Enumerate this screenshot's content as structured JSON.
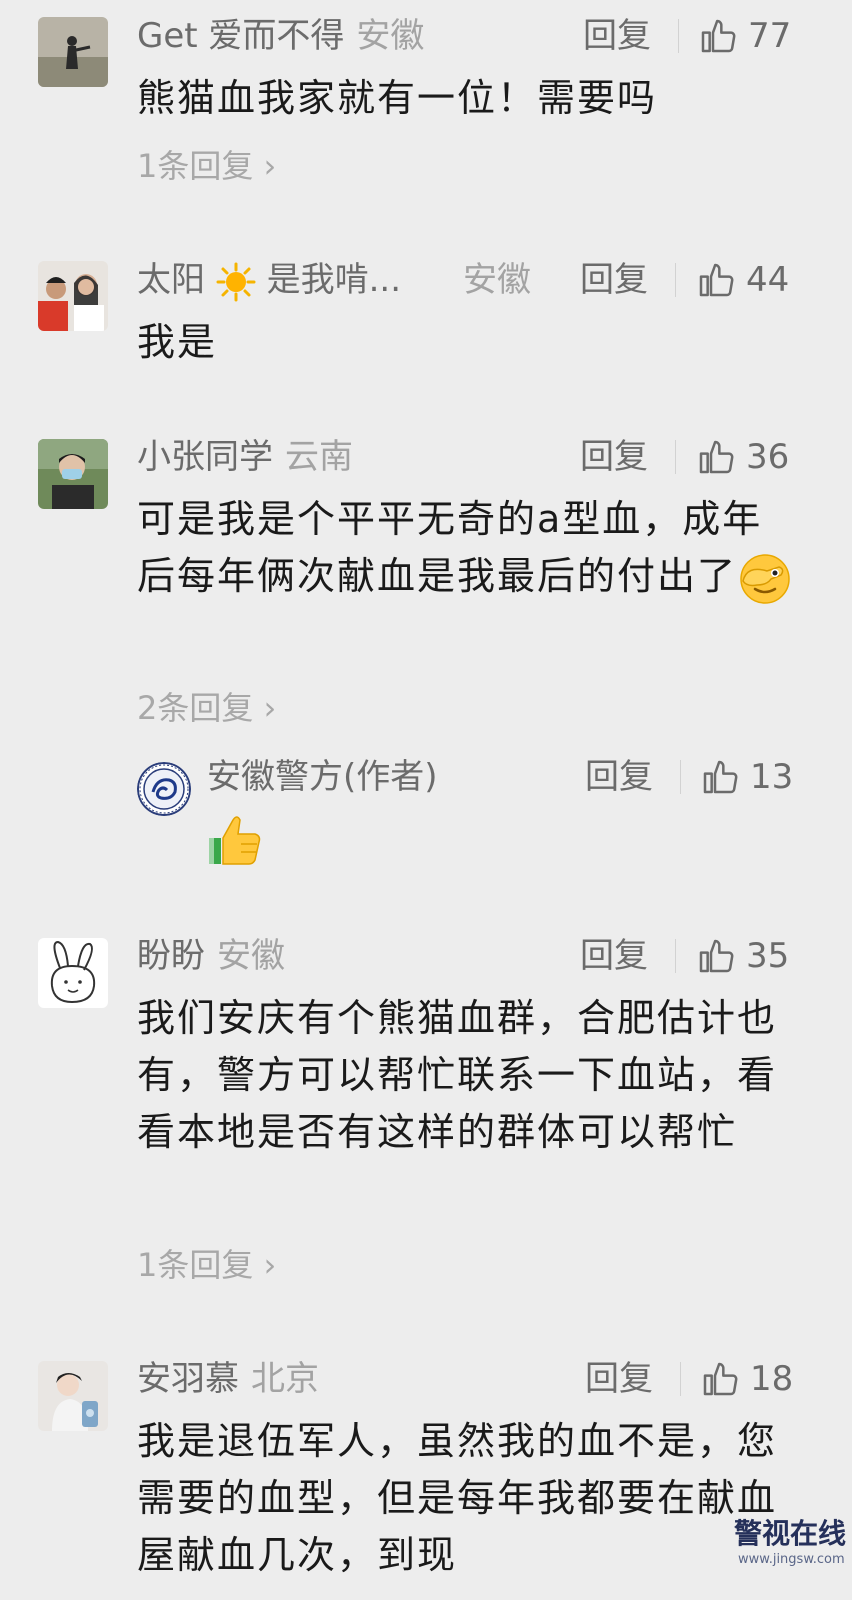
{
  "comments": [
    {
      "name": "Get 爱而不得",
      "location": "安徽",
      "reply_label": "回复",
      "likes": "77",
      "text": "熊猫血我家就有一位！需要吗",
      "more_replies": "1条回复"
    },
    {
      "name": "太阳",
      "name_suffix": "是我啃...",
      "location": "安徽",
      "reply_label": "回复",
      "likes": "44",
      "text": "我是"
    },
    {
      "name": "小张同学",
      "location": "云南",
      "reply_label": "回复",
      "likes": "36",
      "text": "可是我是个平平无奇的a型血，成年后每年俩次献血是我最后的付出了",
      "more_replies": "2条回复",
      "author_reply": {
        "name": "安徽警方(作者)",
        "reply_label": "回复",
        "likes": "13"
      }
    },
    {
      "name": "盼盼",
      "location": "安徽",
      "reply_label": "回复",
      "likes": "35",
      "text": "我们安庆有个熊猫血群，合肥估计也有，警方可以帮忙联系一下血站，看看本地是否有这样的群体可以帮忙",
      "more_replies": "1条回复"
    },
    {
      "name": "安羽慕",
      "location": "北京",
      "reply_label": "回复",
      "likes": "18",
      "text": "我是退伍军人，虽然我的血不是，您需要的血型，但是每年我都要在献血屋献血几次，到现"
    }
  ],
  "watermark": {
    "text": "警视在线",
    "url": "www.jingsw.com"
  },
  "colors": {
    "background": "#ededed",
    "name": "#6b6b6b",
    "location": "#a3a3a3",
    "text": "#1a1a1a"
  },
  "icons": [
    "thumbs-up-icon",
    "chevron-right-icon",
    "sun-emoji",
    "facepalm-emoji",
    "thumbs-up-emoji"
  ]
}
